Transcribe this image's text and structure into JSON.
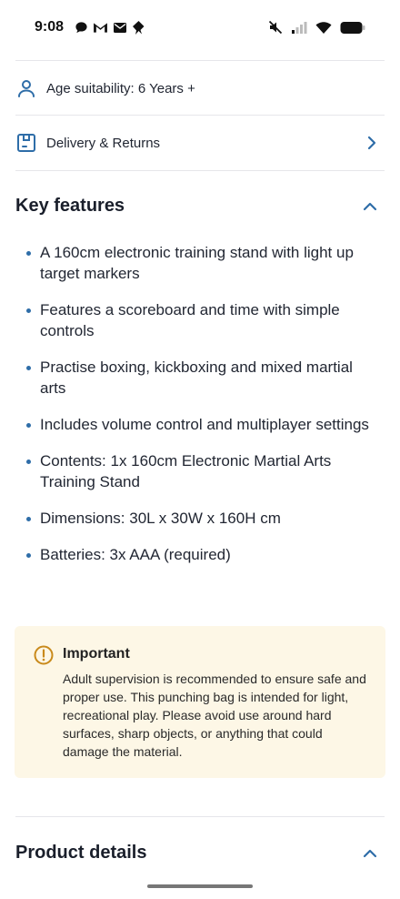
{
  "status_bar": {
    "time": "9:08",
    "left_icons": [
      "chat-icon",
      "gmail-icon",
      "mail-icon",
      "app-icon"
    ],
    "right_icons": [
      "mute-icon",
      "signal-icon",
      "wifi-icon",
      "battery-icon"
    ]
  },
  "rows": {
    "age": {
      "label": "Age suitability: 6 Years +",
      "icon": "person-icon"
    },
    "delivery": {
      "label": "Delivery & Returns",
      "icon": "box-icon",
      "chevron": "chevron-right-icon"
    }
  },
  "key_features": {
    "title": "Key features",
    "items": [
      "A 160cm electronic training stand with light up target markers",
      "Features a scoreboard and time with simple controls",
      "Practise boxing, kickboxing and mixed martial arts",
      "Includes volume control and multiplayer settings",
      "Contents: 1x 160cm Electronic Martial Arts Training Stand",
      "Dimensions: 30L x 30W x 160H cm",
      "Batteries: 3x AAA (required)"
    ]
  },
  "important": {
    "title": "Important",
    "body": "Adult supervision is recommended to ensure safe and proper use. This punching bag is intended for light, recreational play. Please avoid use around hard surfaces, sharp objects, or anything that could damage the material."
  },
  "product_details": {
    "title": "Product details"
  },
  "colors": {
    "accent": "#2e6da8",
    "important_bg": "#fdf7e6",
    "warning": "#c98a1b"
  }
}
